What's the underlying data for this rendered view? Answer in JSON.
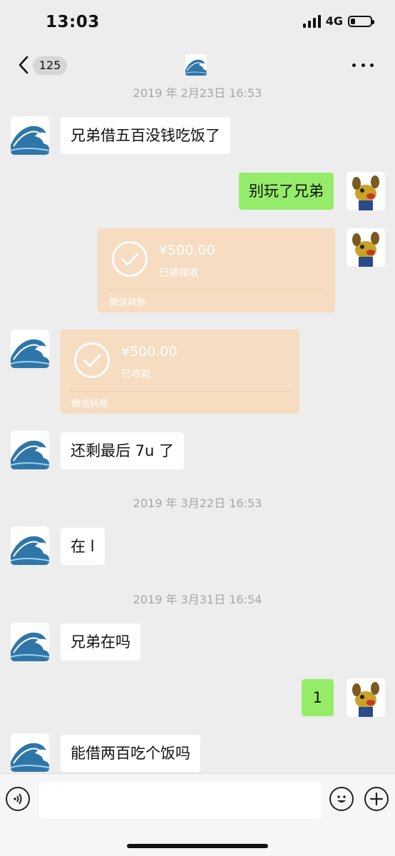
{
  "status_bar": {
    "time": "13:03",
    "network": "4G"
  },
  "nav": {
    "unread_count": "125"
  },
  "messages": [
    {
      "type": "timestamp",
      "text": "2019 年 2月23日 16:53"
    },
    {
      "type": "text",
      "side": "in",
      "text": "兄弟借五百没钱吃饭了"
    },
    {
      "type": "text",
      "side": "out",
      "text": "别玩了兄弟"
    },
    {
      "type": "transfer",
      "side": "out",
      "amount": "¥500.00",
      "status": "已被接收",
      "source": "微信转账"
    },
    {
      "type": "transfer",
      "side": "in",
      "amount": "¥500.00",
      "status": "已收款",
      "source": "微信转账"
    },
    {
      "type": "text",
      "side": "in",
      "text": "还剩最后 7u 了"
    },
    {
      "type": "timestamp",
      "text": "2019 年 3月22日 16:53"
    },
    {
      "type": "text",
      "side": "in",
      "text": "在 l"
    },
    {
      "type": "timestamp",
      "text": "2019 年 3月31日 16:54"
    },
    {
      "type": "text",
      "side": "in",
      "text": "兄弟在吗"
    },
    {
      "type": "text",
      "side": "out",
      "text": "1"
    },
    {
      "type": "text",
      "side": "in",
      "text": "能借两百吃个饭吗"
    }
  ],
  "colors": {
    "background": "#ededed",
    "outgoing_bubble": "#95ec69",
    "incoming_bubble": "#ffffff",
    "transfer_card": "#f6dcc0",
    "timestamp_text": "#a6a6a6"
  },
  "icons": [
    "back-icon",
    "wave-avatar-icon",
    "more-icon",
    "voice-icon",
    "emoji-icon",
    "plus-icon",
    "dog-avatar-icon",
    "check-circle-icon"
  ]
}
